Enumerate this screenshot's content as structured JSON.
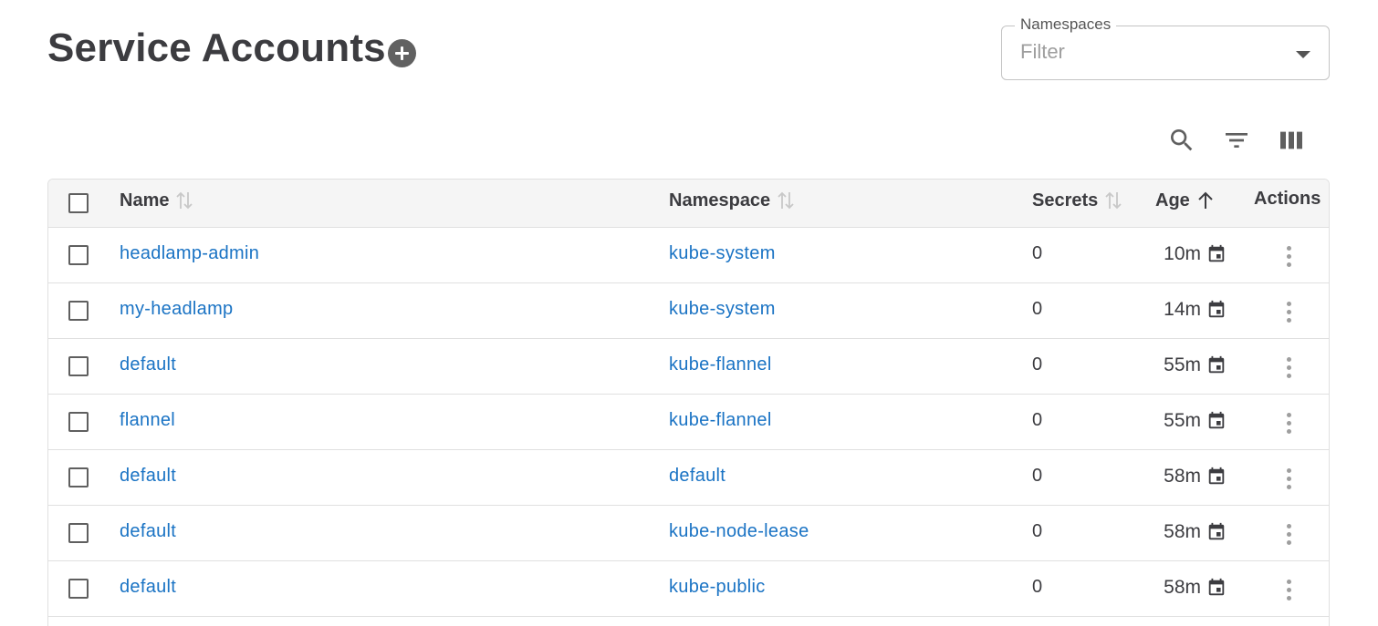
{
  "header": {
    "title": "Service Accounts"
  },
  "namespaces": {
    "label": "Namespaces",
    "placeholder": "Filter"
  },
  "toolbar": {
    "icons": [
      "search-icon",
      "filter-icon",
      "columns-icon"
    ]
  },
  "table": {
    "columns": {
      "name": "Name",
      "namespace": "Namespace",
      "secrets": "Secrets",
      "age": "Age",
      "actions": "Actions"
    },
    "rows": [
      {
        "name": "headlamp-admin",
        "namespace": "kube-system",
        "secrets": "0",
        "age": "10m"
      },
      {
        "name": "my-headlamp",
        "namespace": "kube-system",
        "secrets": "0",
        "age": "14m"
      },
      {
        "name": "default",
        "namespace": "kube-flannel",
        "secrets": "0",
        "age": "55m"
      },
      {
        "name": "flannel",
        "namespace": "kube-flannel",
        "secrets": "0",
        "age": "55m"
      },
      {
        "name": "default",
        "namespace": "default",
        "secrets": "0",
        "age": "58m"
      },
      {
        "name": "default",
        "namespace": "kube-node-lease",
        "secrets": "0",
        "age": "58m"
      },
      {
        "name": "default",
        "namespace": "kube-public",
        "secrets": "0",
        "age": "58m"
      }
    ]
  },
  "colors": {
    "link": "#1a73c4",
    "header_bg": "#f5f5f5",
    "title": "#3c3c40"
  }
}
